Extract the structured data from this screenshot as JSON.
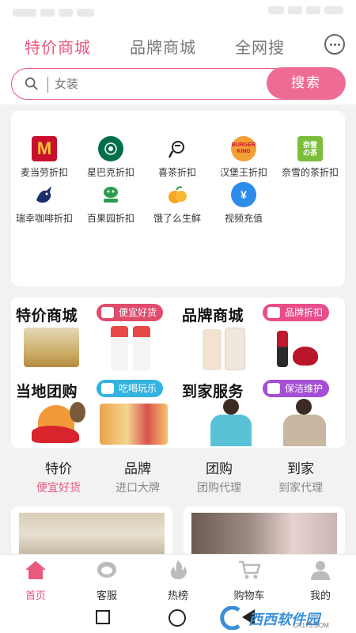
{
  "top_tabs": [
    {
      "label": "特价商城",
      "active": true
    },
    {
      "label": "品牌商城",
      "active": false
    },
    {
      "label": "全网搜",
      "active": false
    }
  ],
  "search": {
    "placeholder": "女装",
    "button": "搜索"
  },
  "brands": [
    {
      "name": "麦当劳折扣",
      "icon": "mcdonalds-logo",
      "color": "#c8102e"
    },
    {
      "name": "星巴克折扣",
      "icon": "starbucks-logo",
      "color": "#00704a"
    },
    {
      "name": "喜茶折扣",
      "icon": "heytea-logo",
      "color": "#222222"
    },
    {
      "name": "汉堡王折扣",
      "icon": "burger-king-logo",
      "color": "#f4a037"
    },
    {
      "name": "奈雪的茶折扣",
      "icon": "naixue-logo",
      "color": "#7cbd3c"
    },
    {
      "name": "瑞幸咖啡折扣",
      "icon": "luckin-logo",
      "color": "#1a2f6b"
    },
    {
      "name": "百果园折扣",
      "icon": "pagoda-logo",
      "color": "#2e9c4e"
    },
    {
      "name": "饿了么生鲜",
      "icon": "orange-icon",
      "color": "#f5a623"
    },
    {
      "name": "视频充值",
      "icon": "video-recharge-icon",
      "color": "#2d8ce8"
    }
  ],
  "features": [
    {
      "title": "特价商城",
      "badge": "便宜好货",
      "badge_color": "#e04c6c"
    },
    {
      "title": "品牌商城",
      "badge": "品牌折扣",
      "badge_color": "#ea4c8a"
    },
    {
      "title": "当地团购",
      "badge": "吃喝玩乐",
      "badge_color": "#33b3e0"
    },
    {
      "title": "到家服务",
      "badge": "保洁维护",
      "badge_color": "#a44fd6"
    }
  ],
  "categories": [
    {
      "title": "特价",
      "subtitle": "便宜好货",
      "active": true
    },
    {
      "title": "品牌",
      "subtitle": "进口大牌",
      "active": false
    },
    {
      "title": "团购",
      "subtitle": "团购代理",
      "active": false
    },
    {
      "title": "到家",
      "subtitle": "到家代理",
      "active": false
    }
  ],
  "bottom_nav": [
    {
      "label": "首页",
      "icon": "home-icon",
      "active": true
    },
    {
      "label": "客服",
      "icon": "customer-service-icon",
      "active": false
    },
    {
      "label": "热榜",
      "icon": "flame-icon",
      "active": false
    },
    {
      "label": "购物车",
      "icon": "cart-icon",
      "active": false
    },
    {
      "label": "我的",
      "icon": "user-icon",
      "active": false
    }
  ],
  "watermark": {
    "text": "西西软件园",
    "sub": "CR173.COM"
  },
  "colors": {
    "accent": "#e9587f",
    "search_button": "#ee6c94"
  }
}
